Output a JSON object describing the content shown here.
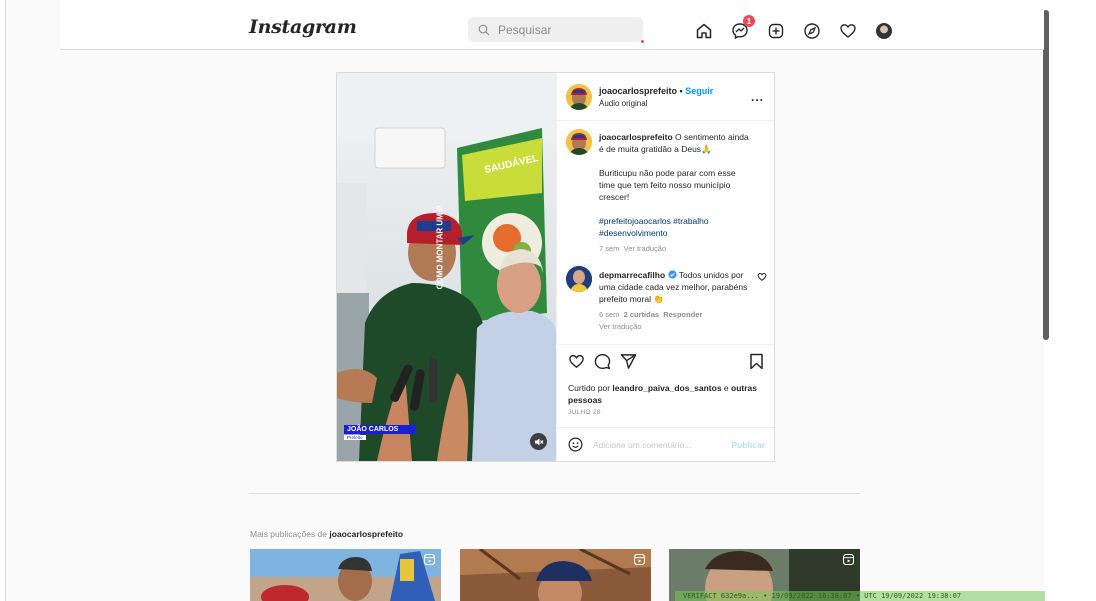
{
  "app": {
    "logo": "Instagram"
  },
  "search": {
    "placeholder": "Pesquisar"
  },
  "nav": {
    "items": [
      "home-icon",
      "messenger-icon",
      "new-post-icon",
      "explore-icon",
      "activity-icon",
      "profile-avatar"
    ],
    "messenger_badge": "1"
  },
  "post": {
    "author": "joaocarlosprefeito",
    "separator": "•",
    "follow_label": "Seguir",
    "audio": "Áudio original",
    "more_label": "...",
    "caption": {
      "user": "joaocarlosprefeito",
      "line1": " O sentimento ainda é de muita gratidão a Deus🙏",
      "line2": "Buriticupu não pode parar com esse time que tem feito nosso município crescer!",
      "hashtags": "#prefeitojoaocarlos #trabalho #desenvolvimento",
      "time": "7 sem",
      "translate": "Ver tradução"
    },
    "reply": {
      "user": "depmarrecafilho",
      "text": " Todos unidos por uma cidade cada vez melhor, parabéns prefeito moral 👏",
      "time": "6 sem",
      "likes": "2 curtidas",
      "reply_label": "Responder",
      "translate": "Ver tradução"
    },
    "liked_prefix": "Curtido por ",
    "liked_user": "leandro_paiva_dos_santos",
    "liked_mid": " e ",
    "liked_others": "outras pessoas",
    "date": "JULHO 28",
    "comment_placeholder": "Adicione um comentário...",
    "publish_label": "Publicar",
    "media_overlay_name": "JOÃO CARLOS",
    "media_overlay_sub": "Prefeito",
    "media_sign": "SAUDÁVEL",
    "media_sign_side": "COMO MONTAR UM P"
  },
  "more_posts": {
    "prefix": "Mais publicações de ",
    "user": "joaocarlosprefeito"
  },
  "watermark": "VERIFACT 632e9a... • 19/09/2022 16:38:07 • UTC 19/09/2022 19:38:07",
  "colors": {
    "accent": "#0095f6",
    "badge": "#ed4956",
    "hashtag": "#00376b"
  }
}
